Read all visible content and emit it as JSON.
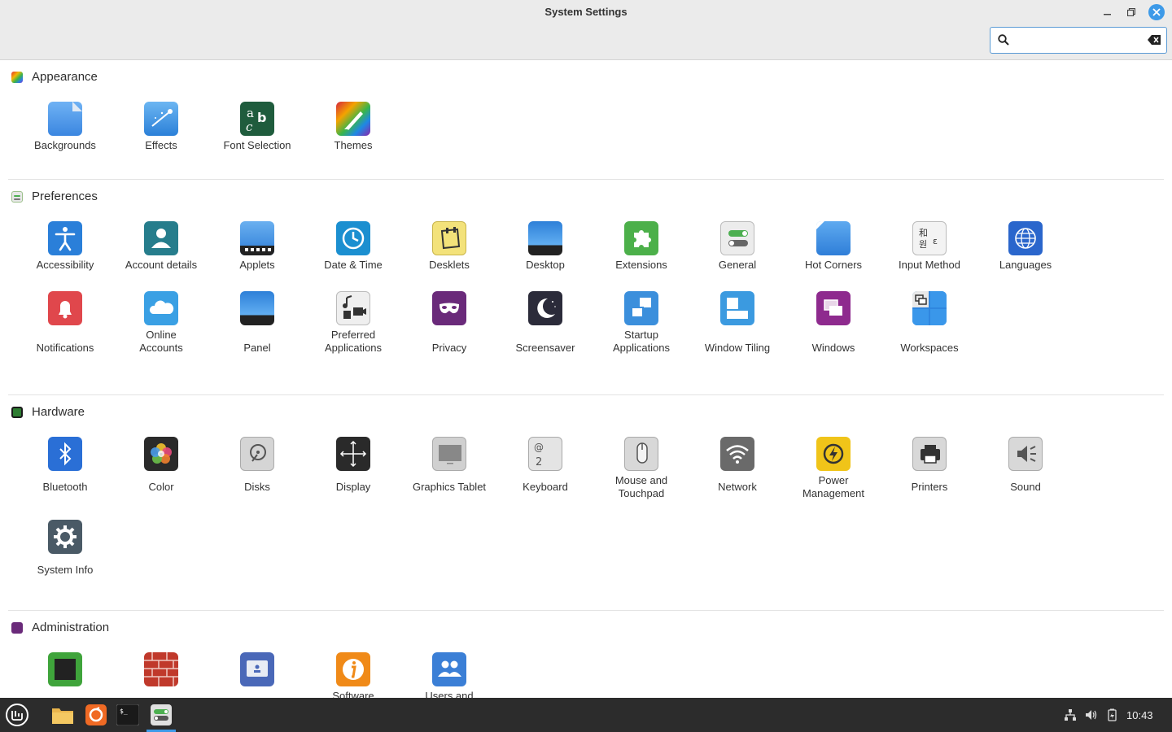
{
  "window": {
    "title": "System Settings",
    "search": {
      "value": "",
      "placeholder": ""
    }
  },
  "sections": {
    "appearance": {
      "title": "Appearance",
      "items": [
        "Backgrounds",
        "Effects",
        "Font Selection",
        "Themes"
      ]
    },
    "preferences": {
      "title": "Preferences",
      "items": [
        "Accessibility",
        "Account details",
        "Applets",
        "Date & Time",
        "Desklets",
        "Desktop",
        "Extensions",
        "General",
        "Hot Corners",
        "Input Method",
        "Languages",
        "Notifications",
        "Online\nAccounts",
        "Panel",
        "Preferred\nApplications",
        "Privacy",
        "Screensaver",
        "Startup\nApplications",
        "Window Tiling",
        "Windows",
        "Workspaces"
      ]
    },
    "hardware": {
      "title": "Hardware",
      "items": [
        "Bluetooth",
        "Color",
        "Disks",
        "Display",
        "Graphics Tablet",
        "Keyboard",
        "Mouse and\nTouchpad",
        "Network",
        "Power\nManagement",
        "Printers",
        "Sound",
        "System Info"
      ]
    },
    "administration": {
      "title": "Administration",
      "items": [
        "",
        "",
        "",
        "Software",
        "Users and"
      ]
    }
  },
  "taskbar": {
    "clock": "10:43",
    "apps": [
      "menu-icon",
      "files-icon",
      "software-manager-icon",
      "terminal-icon",
      "system-settings-icon"
    ]
  },
  "colors": {
    "accent": "#3d9ae8",
    "panel": "#2c2c2c",
    "titlebar": "#ebebeb"
  }
}
